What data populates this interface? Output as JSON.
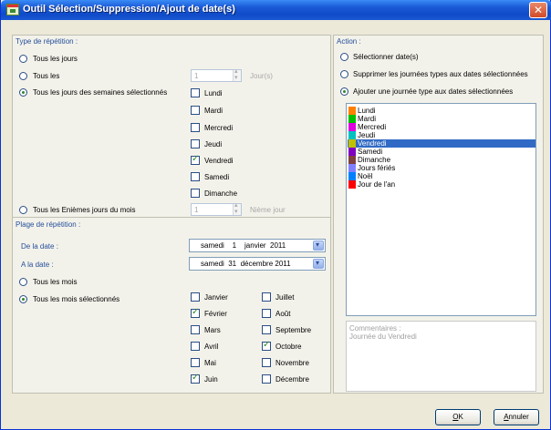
{
  "window": {
    "title": "Outil Sélection/Suppression/Ajout de date(s)"
  },
  "left": {
    "repetition_title": "Type de répétition :",
    "opt_every_day": "Tous les jours",
    "opt_every_n": "Tous les",
    "every_n_value": "1",
    "every_n_unit": "Jour(s)",
    "opt_weekdays": "Tous les jours des semaines sélectionnés",
    "weekdays": [
      {
        "label": "Lundi",
        "checked": false
      },
      {
        "label": "Mardi",
        "checked": false
      },
      {
        "label": "Mercredi",
        "checked": false
      },
      {
        "label": "Jeudi",
        "checked": false
      },
      {
        "label": "Vendredi",
        "checked": true
      },
      {
        "label": "Samedi",
        "checked": false
      },
      {
        "label": "Dimanche",
        "checked": false
      }
    ],
    "opt_nth_day": "Tous les Enièmes jours du mois",
    "nth_value": "1",
    "nth_unit": "Nième jour",
    "range_title": "Plage de répétition :",
    "from_label": "De la date :",
    "from_value": "samedi    1    janvier  2011",
    "to_label": "A la date :",
    "to_value": "samedi  31  décembre 2011",
    "opt_every_month": "Tous les mois",
    "opt_selected_months": "Tous les mois sélectionnés",
    "months": [
      {
        "label": "Janvier",
        "checked": false
      },
      {
        "label": "Février",
        "checked": true
      },
      {
        "label": "Mars",
        "checked": false
      },
      {
        "label": "Avril",
        "checked": false
      },
      {
        "label": "Mai",
        "checked": false
      },
      {
        "label": "Juin",
        "checked": true
      },
      {
        "label": "Juillet",
        "checked": false
      },
      {
        "label": "Août",
        "checked": false
      },
      {
        "label": "Septembre",
        "checked": false
      },
      {
        "label": "Octobre",
        "checked": true
      },
      {
        "label": "Novembre",
        "checked": false
      },
      {
        "label": "Décembre",
        "checked": false
      }
    ]
  },
  "right": {
    "action_title": "Action :",
    "opt_select": "Sélectionner date(s)",
    "opt_delete": "Supprimer les journées types aux dates sélectionnées",
    "opt_add": "Ajouter une journée type aux dates sélectionnées",
    "day_types": [
      {
        "label": "Lundi",
        "color": "#ff8000"
      },
      {
        "label": "Mardi",
        "color": "#00c000"
      },
      {
        "label": "Mercredi",
        "color": "#e000e0"
      },
      {
        "label": "Jeudi",
        "color": "#00c0c0"
      },
      {
        "label": "Vendredi",
        "color": "#c0c000"
      },
      {
        "label": "Samedi",
        "color": "#8000c0"
      },
      {
        "label": "Dimanche",
        "color": "#804040"
      },
      {
        "label": "Jours fériés",
        "color": "#8080ff"
      },
      {
        "label": "Noël",
        "color": "#0080ff"
      },
      {
        "label": "Jour de l'an",
        "color": "#ff0000"
      }
    ],
    "selected_index": 4,
    "comments_label": "Commentaires :",
    "comments_text": "Journée du Vendredi"
  },
  "buttons": {
    "ok_mnemonic": "O",
    "ok_rest": "K",
    "cancel_mnemonic": "A",
    "cancel_rest": "nnuler"
  }
}
